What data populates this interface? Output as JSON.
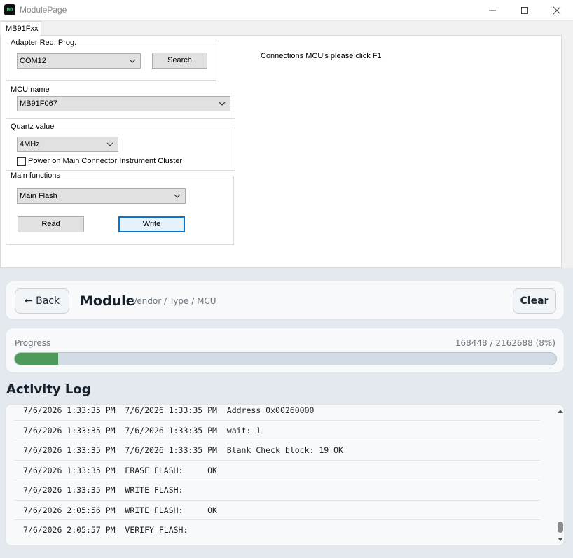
{
  "window": {
    "title": "ModulePage",
    "icon_text": "MD",
    "controls": [
      "minimize-icon",
      "maximize-icon",
      "close-icon"
    ]
  },
  "tab": {
    "label": "MB91Fxx"
  },
  "adapter": {
    "label": "Adapter Red. Prog.",
    "port": "COM12",
    "search_label": "Search"
  },
  "status_text": "Connections MCU's please click F1",
  "mcu": {
    "label": "MCU name",
    "value": "MB91F067"
  },
  "quartz": {
    "label": "Quartz value",
    "value": "4MHz",
    "power_label": "Power on Main Connector Instrument Cluster",
    "power_checked": false
  },
  "functions": {
    "label": "Main functions",
    "value": "Main Flash",
    "read_label": "Read",
    "write_label": "Write"
  },
  "header": {
    "back_label": "← Back",
    "title": "Module",
    "subtitle": "Vendor / Type / MCU",
    "clear_label": "Clear"
  },
  "progress": {
    "label": "Progress",
    "count_text": "168448 / 2162688 (8%)",
    "fraction": 0.08,
    "color": "#4e9a5a"
  },
  "log": {
    "title": "Activity Log",
    "rows": [
      "7/6/2026 1:33:35 PM  7/6/2026 1:33:35 PM  Address 0x00260000",
      "7/6/2026 1:33:35 PM  7/6/2026 1:33:35 PM  wait: 1",
      "7/6/2026 1:33:35 PM  7/6/2026 1:33:35 PM  Blank Check block: 19 OK",
      "7/6/2026 1:33:35 PM  ERASE FLASH:     OK",
      "7/6/2026 1:33:35 PM  WRITE FLASH:",
      "7/6/2026 2:05:56 PM  WRITE FLASH:     OK",
      "7/6/2026 2:05:57 PM  VERIFY FLASH:"
    ]
  }
}
